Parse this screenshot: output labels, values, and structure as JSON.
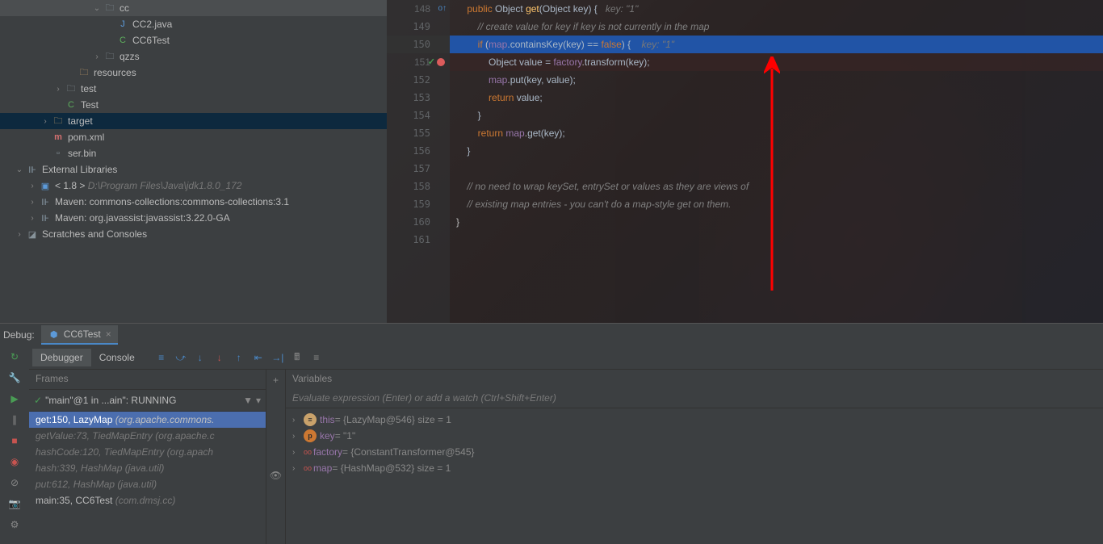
{
  "tree": {
    "cc": "cc",
    "cc2java": "CC2.java",
    "cc6test": "CC6Test",
    "qzzs": "qzzs",
    "test": "test",
    "testClass": "Test",
    "resources": "resources",
    "target": "target",
    "pom": "pom.xml",
    "serbin": "ser.bin",
    "extLibs": "External Libraries",
    "jdk": "< 1.8 >",
    "jdkPath": "D:\\Program Files\\Java\\jdk1.8.0_172",
    "maven1": "Maven: commons-collections:commons-collections:3.1",
    "maven2": "Maven: org.javassist:javassist:3.22.0-GA",
    "scratches": "Scratches and Consoles"
  },
  "code": {
    "l148": {
      "kw1": "public",
      "type": "Object",
      "method": "get",
      "sig": "(Object key) {",
      "hint": "key: \"1\""
    },
    "l149": "// create value for key if key is not currently in the map",
    "l150": {
      "kw": "if",
      "field": "map",
      "method": "containsKey",
      "arg": "(key)",
      "op": " == ",
      "val": "false",
      "end": ") {",
      "hint": "key: \"1\""
    },
    "l151": {
      "type": "Object",
      "var": "value",
      "op": " = ",
      "field": "factory",
      "method": "transform",
      "arg": "(key);"
    },
    "l152": {
      "field": "map",
      "method": "put",
      "arg": "(key, value);"
    },
    "l153": {
      "kw": "return",
      "var": " value;"
    },
    "l154": "}",
    "l155": {
      "kw": "return",
      "field": " map",
      "method": "get",
      "arg": "(key);"
    },
    "l156": "}",
    "l158": "// no need to wrap keySet, entrySet or values as they are views of",
    "l159": "// existing map entries - you can't do a map-style get on them."
  },
  "lineNums": [
    "148",
    "149",
    "150",
    "151",
    "152",
    "153",
    "154",
    "155",
    "156",
    "157",
    "158",
    "159",
    "160",
    "161"
  ],
  "debug": {
    "label": "Debug:",
    "tabName": "CC6Test",
    "tabs": {
      "debugger": "Debugger",
      "console": "Console"
    },
    "framesHeader": "Frames",
    "varsHeader": "Variables",
    "thread": "\"main\"@1 in ...ain\": RUNNING",
    "frames": [
      {
        "loc": "get:150, LazyMap",
        "pkg": "(org.apache.commons.",
        "active": true
      },
      {
        "loc": "getValue:73, TiedMapEntry",
        "pkg": "(org.apache.c"
      },
      {
        "loc": "hashCode:120, TiedMapEntry",
        "pkg": "(org.apach"
      },
      {
        "loc": "hash:339, HashMap",
        "pkg": "(java.util)"
      },
      {
        "loc": "put:612, HashMap",
        "pkg": "(java.util)"
      },
      {
        "loc": "main:35, CC6Test",
        "pkg": "(com.dmsj.cc)"
      }
    ],
    "evalPlaceholder": "Evaluate expression (Enter) or add a watch (Ctrl+Shift+Enter)",
    "vars": [
      {
        "icon": "this",
        "name": "this",
        "val": " = {LazyMap@546}  size = 1"
      },
      {
        "icon": "param",
        "name": "key",
        "val": " = \"1\""
      },
      {
        "icon": "field",
        "name": "factory",
        "val": " = {ConstantTransformer@545}",
        "oo": true
      },
      {
        "icon": "field",
        "name": "map",
        "val": " = {HashMap@532}  size = 1",
        "oo": true
      }
    ]
  }
}
